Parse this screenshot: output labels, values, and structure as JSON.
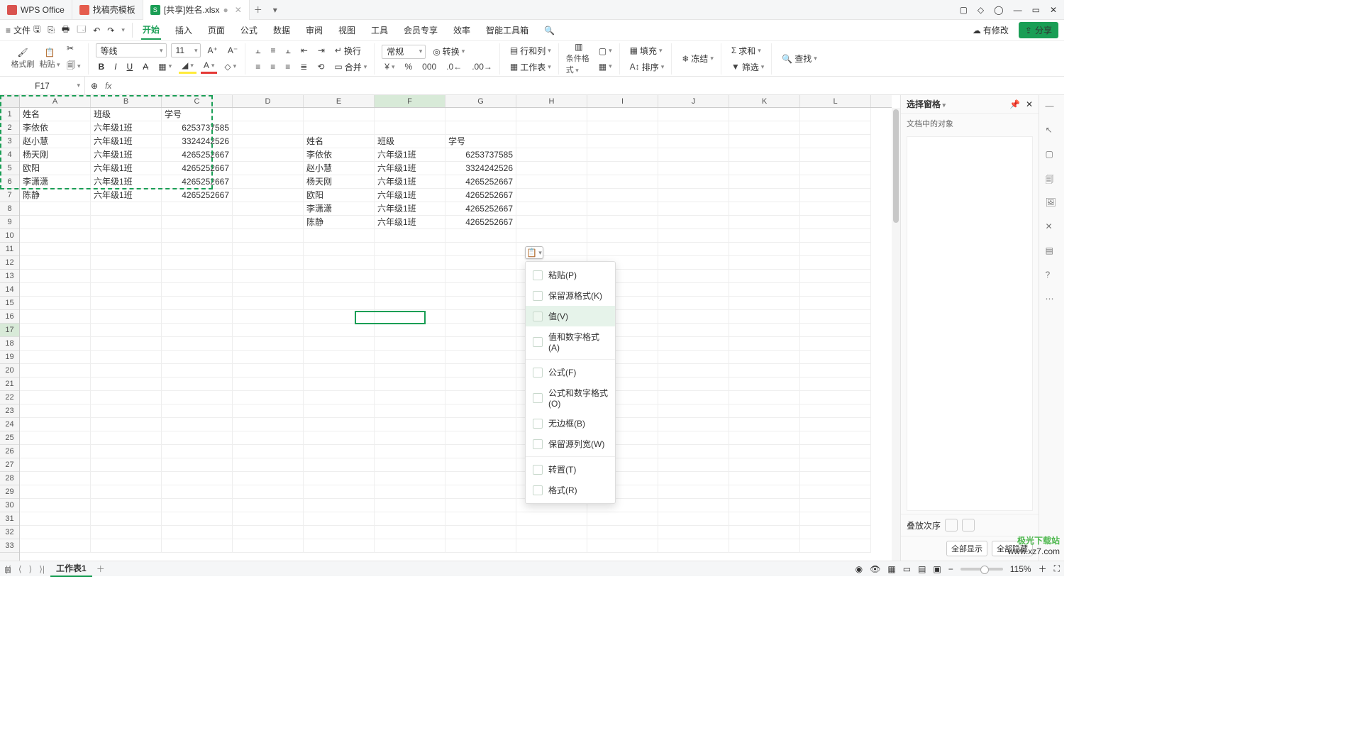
{
  "tabs": [
    {
      "label": "WPS Office"
    },
    {
      "label": "找稿壳模板"
    },
    {
      "label": "[共享]姓名.xlsx",
      "dirty": "●",
      "active": true
    }
  ],
  "file_menu": "文件",
  "menu": {
    "items": [
      "开始",
      "插入",
      "页面",
      "公式",
      "数据",
      "审阅",
      "视图",
      "工具",
      "会员专享",
      "效率",
      "智能工具箱"
    ],
    "active": "开始"
  },
  "topright": {
    "pending": "有修改",
    "share": "分享"
  },
  "ribbon": {
    "fmt_brush": "格式刷",
    "paste": "粘贴",
    "font": "等线",
    "size": "11",
    "normal": "常规",
    "convert": "转换",
    "rowcol": "行和列",
    "worksheet": "工作表",
    "condfmt": "条件格式",
    "sum": "求和",
    "filter": "筛选",
    "find": "查找",
    "fill": "填充",
    "sort": "排序",
    "freeze": "冻结",
    "wrap": "换行",
    "merge": "合并"
  },
  "namebox": "F17",
  "cols": [
    "A",
    "B",
    "C",
    "D",
    "E",
    "F",
    "G",
    "H",
    "I",
    "J",
    "K",
    "L"
  ],
  "rowcount": 33,
  "left_table": {
    "header": [
      "姓名",
      "班级",
      "学号"
    ],
    "rows": [
      [
        "李依依",
        "六年级1班",
        "6253737585"
      ],
      [
        "赵小慧",
        "六年级1班",
        "3324242526"
      ],
      [
        "杨天刚",
        "六年级1班",
        "4265252667"
      ],
      [
        "欧阳",
        "六年级1班",
        "4265252667"
      ],
      [
        "李潇潇",
        "六年级1班",
        "4265252667"
      ],
      [
        "陈静",
        "六年级1班",
        "4265252667"
      ]
    ]
  },
  "right_table": {
    "header": [
      "姓名",
      "班级",
      "学号"
    ],
    "rows": [
      [
        "李依依",
        "六年级1班",
        "6253737585"
      ],
      [
        "赵小慧",
        "六年级1班",
        "3324242526"
      ],
      [
        "杨天刚",
        "六年级1班",
        "4265252667"
      ],
      [
        "欧阳",
        "六年级1班",
        "4265252667"
      ],
      [
        "李潇潇",
        "六年级1班",
        "4265252667"
      ],
      [
        "陈静",
        "六年级1班",
        "4265252667"
      ]
    ]
  },
  "ctx": {
    "paste": "粘贴(P)",
    "keepfmt": "保留源格式(K)",
    "value": "值(V)",
    "valuefmt": "值和数字格式(A)",
    "formula": "公式(F)",
    "formulafmt": "公式和数字格式(O)",
    "noborder": "无边框(B)",
    "keepwidth": "保留源列宽(W)",
    "transpose": "转置(T)",
    "format": "格式(R)"
  },
  "pane": {
    "title": "选择窗格",
    "subtitle": "文档中的对象",
    "stack": "叠放次序",
    "showall": "全部显示",
    "hideall": "全部隐藏"
  },
  "status": {
    "sheet": "工作表1",
    "zoom": "115%"
  },
  "logo": {
    "l1": "极光下载站",
    "l2": "www.xz7.com"
  }
}
